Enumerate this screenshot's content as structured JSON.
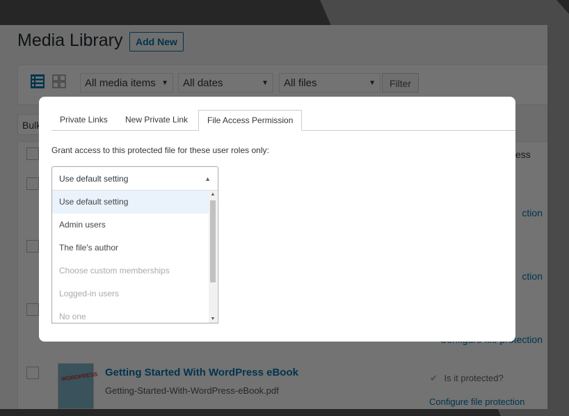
{
  "page": {
    "title": "Media Library",
    "add_new_label": "Add New"
  },
  "toolbar": {
    "media_filter": "All media items",
    "date_filter": "All dates",
    "file_filter": "All files",
    "filter_label": "Filter",
    "bulk_label": "Bulk"
  },
  "table": {
    "col_right_partial": "ess",
    "link_partial_1": "ction",
    "link_partial_2": "ction",
    "link_partial_3": "Configure file protection",
    "row": {
      "thumb_text": "WORDPRESS",
      "title": "Getting Started With WordPress eBook",
      "filename": "Getting-Started-With-WordPress-eBook.pdf",
      "protected_label": "Is it protected?",
      "configure_label": "Configure file protection"
    }
  },
  "modal": {
    "tabs": [
      {
        "label": "Private Links"
      },
      {
        "label": "New Private Link"
      },
      {
        "label": "File Access Permission"
      }
    ],
    "grant_label": "Grant access to this protected file for these user roles only:",
    "select": {
      "current": "Use default setting",
      "options": [
        {
          "label": "Use default setting",
          "state": "highlighted"
        },
        {
          "label": "Admin users",
          "state": "enabled"
        },
        {
          "label": "The file's author",
          "state": "enabled"
        },
        {
          "label": "Choose custom memberships",
          "state": "disabled"
        },
        {
          "label": "Logged-in users",
          "state": "disabled"
        },
        {
          "label": "No one",
          "state": "disabled"
        }
      ]
    }
  },
  "colors": {
    "accent": "#0073aa",
    "highlight": "#eaf3fb"
  }
}
